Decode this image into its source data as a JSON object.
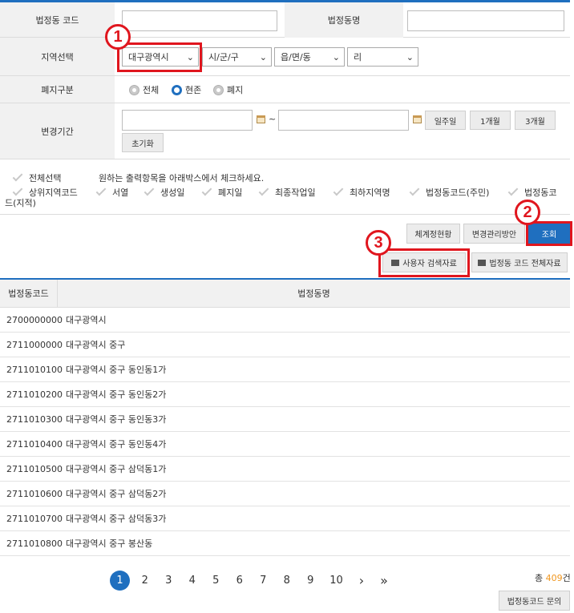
{
  "form": {
    "code_label": "법정동 코드",
    "name_label": "법정동명",
    "code_value": "",
    "name_value": "",
    "region_label": "지역선택",
    "region_selects": [
      "대구광역시",
      "시/군/구",
      "읍/면/동",
      "리"
    ],
    "abolish_label": "폐지구분",
    "abolish_options": [
      "전체",
      "현존",
      "폐지"
    ],
    "abolish_selected": "현존",
    "period_label": "변경기간",
    "period_sep": "~",
    "period_buttons": [
      "일주일",
      "1개월",
      "3개월"
    ],
    "reset_button": "초기화"
  },
  "columns": {
    "select_all": "전체선택",
    "hint": "원하는 출력항목을 아래박스에서 체크하세요.",
    "items": [
      "상위지역코드",
      "서열",
      "생성일",
      "폐지일",
      "최종작업일",
      "최하지역명",
      "법정동코드(주민)",
      "법정동코"
    ],
    "wrap": "드(지적)"
  },
  "actions": {
    "system_status": "체계정현황",
    "change_plan": "변경관리방안",
    "search": "조회",
    "user_data": "사용자 검색자료",
    "all_data": "법정동 코드 전체자료"
  },
  "annotations": [
    "1",
    "2",
    "3"
  ],
  "table": {
    "headers": [
      "법정동코드",
      "법정동명"
    ],
    "rows": [
      {
        "code": "2700000000",
        "name": "대구광역시"
      },
      {
        "code": "2711000000",
        "name": "대구광역시 중구"
      },
      {
        "code": "2711010100",
        "name": "대구광역시 중구 동인동1가"
      },
      {
        "code": "2711010200",
        "name": "대구광역시 중구 동인동2가"
      },
      {
        "code": "2711010300",
        "name": "대구광역시 중구 동인동3가"
      },
      {
        "code": "2711010400",
        "name": "대구광역시 중구 동인동4가"
      },
      {
        "code": "2711010500",
        "name": "대구광역시 중구 삼덕동1가"
      },
      {
        "code": "2711010600",
        "name": "대구광역시 중구 삼덕동2가"
      },
      {
        "code": "2711010700",
        "name": "대구광역시 중구 삼덕동3가"
      },
      {
        "code": "2711010800",
        "name": "대구광역시 중구 봉산동"
      }
    ]
  },
  "pagination": {
    "pages": [
      "1",
      "2",
      "3",
      "4",
      "5",
      "6",
      "7",
      "8",
      "9",
      "10"
    ],
    "current": "1",
    "next": "›",
    "last": "»"
  },
  "total": {
    "prefix": "총 ",
    "count": "409",
    "suffix": "건"
  },
  "inquiry_button": "법정동코드 문의",
  "colors": {
    "accent": "#1f6fbf",
    "highlight": "#e0161e",
    "count": "#f0961e"
  }
}
